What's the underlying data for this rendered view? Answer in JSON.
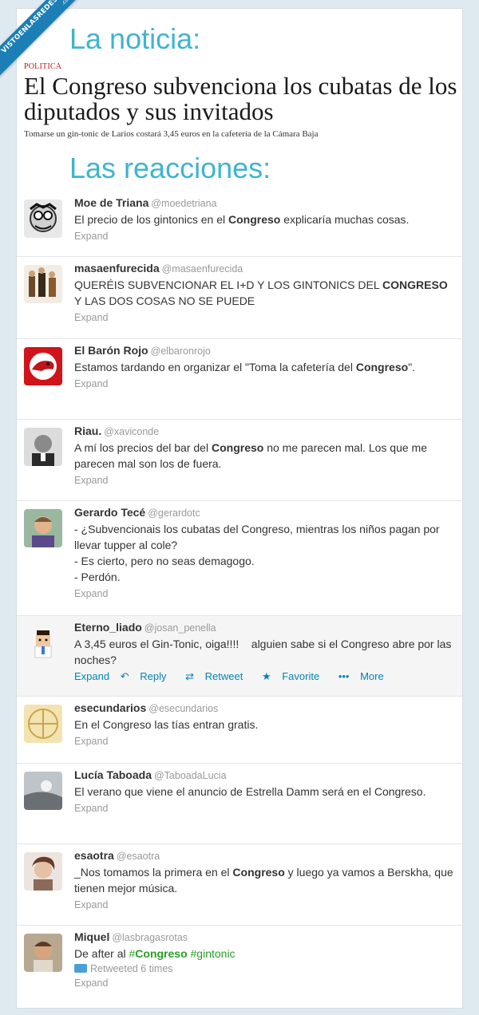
{
  "ribbon": {
    "line1": "VISTOENLASREDES",
    "line2": ".com"
  },
  "sections": {
    "news_label": "La noticia:",
    "reactions_label": "Las reacciones:"
  },
  "news": {
    "section": "POLITICA",
    "headline": "El Congreso subvenciona los cubatas de los diputados y sus invitados",
    "lead": "Tomarse un gin-tonic de Larios costará 3,45 euros en la cafetería de la Cámara Baja"
  },
  "tweets": [
    {
      "name": "Moe de Triana",
      "handle": "@moedetriana",
      "parts": [
        "El precio de los gintonics en el ",
        "Congreso",
        " explicaría muchas cosas."
      ],
      "expand": "Expand"
    },
    {
      "name": "masaenfurecida",
      "handle": "@masaenfurecida",
      "parts": [
        "QUERÉIS SUBVENCIONAR EL I+D Y LOS GINTONICS DEL ",
        "CONGRESO",
        " Y LAS DOS COSAS NO SE PUEDE"
      ],
      "expand": "Expand"
    },
    {
      "name": "El Barón Rojo",
      "handle": "@elbaronrojo",
      "parts": [
        "Estamos tardando en organizar el \"Toma la cafetería del ",
        "Congreso",
        "\"."
      ],
      "expand": "Expand"
    },
    {
      "name": "Riau.",
      "handle": "@xaviconde",
      "parts": [
        "A mí los precios del bar del ",
        "Congreso",
        " no me parecen mal. Los que me parecen mal son los de fuera."
      ],
      "expand": "Expand"
    },
    {
      "name": "Gerardo Tecé",
      "handle": "@gerardotc",
      "lines": [
        "- ¿Subvencionais los cubatas del Congreso, mientras los niños pagan por llevar tupper al cole?",
        "- Es cierto, pero no seas demagogo.",
        "- Perdón."
      ],
      "expand": "Expand"
    },
    {
      "name": "Eterno_liado",
      "handle": "@josan_penella",
      "text": "A 3,45 euros el Gin-Tonic, oiga!!!!    alguien sabe si el Congreso abre por las noches?",
      "actions": {
        "expand": "Expand",
        "reply": "Reply",
        "retweet": "Retweet",
        "favorite": "Favorite",
        "more": "More"
      }
    },
    {
      "name": "esecundarios",
      "handle": "@esecundarios",
      "text": "En el Congreso las tías entran gratis.",
      "expand": "Expand"
    },
    {
      "name": "Lucía Taboada",
      "handle": "@TaboadaLucia",
      "text": "El verano que viene el anuncio de Estrella Damm será en el Congreso.",
      "expand": "Expand"
    },
    {
      "name": "esaotra",
      "handle": "@esaotra",
      "parts": [
        "_Nos tomamos la primera en el ",
        "Congreso",
        " y luego ya vamos a Berskha, que tienen mejor música."
      ],
      "expand": "Expand"
    },
    {
      "name": "Miquel",
      "handle": "@lasbragasrotas",
      "prefix": "De after al ",
      "hash1": "#",
      "hash1b": "Congreso",
      "hash2": " #gintonic",
      "retweeted": "Retweeted 6 times",
      "expand": "Expand"
    }
  ],
  "colors": {
    "accent": "#3fb4cf",
    "ribbon": "#1b7fb6",
    "section_red": "#c0141b",
    "link": "#0084b4",
    "hashtag": "#2a9d26"
  }
}
